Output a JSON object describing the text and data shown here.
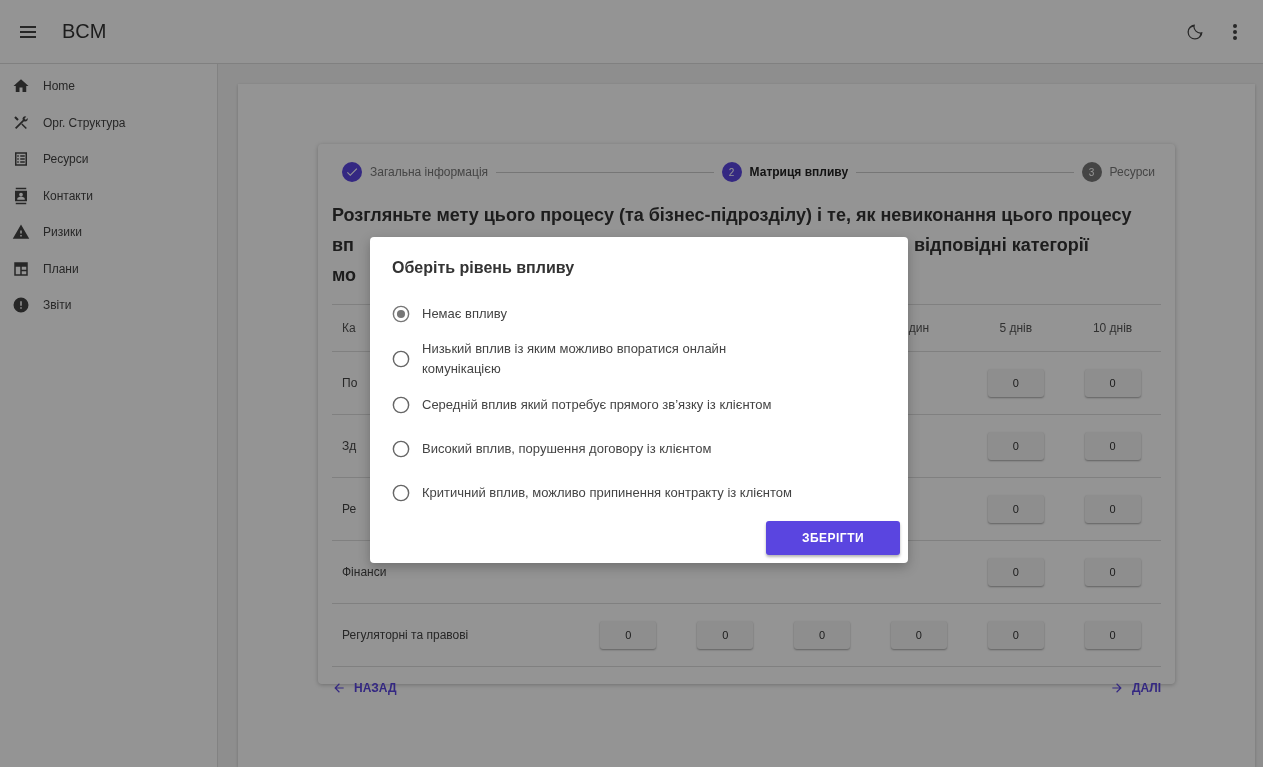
{
  "app_bar": {
    "title": "BCM"
  },
  "sidebar": {
    "items": [
      {
        "label": "Home"
      },
      {
        "label": "Орг. Структура"
      },
      {
        "label": "Ресурси"
      },
      {
        "label": "Контакти"
      },
      {
        "label": "Ризики"
      },
      {
        "label": "Плани"
      },
      {
        "label": "Звіти"
      }
    ]
  },
  "stepper": [
    {
      "label": "Загальна інформація",
      "completed": true,
      "selected": false
    },
    {
      "label": "Матриця впливу",
      "number": "2",
      "completed": false,
      "selected": true
    },
    {
      "label": "Ресурси",
      "number": "3",
      "completed": false,
      "selected": false
    }
  ],
  "heading": {
    "line_1": "Розгляньте мету цього процесу (та бізнес-підрозділу) і те, як невиконання цього процесу",
    "line_2_start": "вп",
    "line_2_end": "відповідні категорії",
    "line_3_start": "мо"
  },
  "table": {
    "label_header": "Ка",
    "columns": [
      "дин",
      "5 днів",
      "10 днів"
    ],
    "rows": [
      {
        "label": "По",
        "values": [
          "0",
          "0"
        ]
      },
      {
        "label": "Зд",
        "values": [
          "0",
          "0"
        ]
      },
      {
        "label": "Ре",
        "values": [
          "0",
          "0"
        ]
      },
      {
        "label": "Фінанси",
        "values": [
          "0",
          "0"
        ]
      },
      {
        "label": "Регуляторні та правові",
        "values": [
          "0",
          "0",
          "0",
          "0",
          "0",
          "0"
        ]
      }
    ]
  },
  "nav": {
    "back": "НАЗАД",
    "next": "ДАЛІ"
  },
  "dialog": {
    "title": "Оберіть рівень впливу",
    "options": [
      {
        "label": "Немає впливу",
        "selected": true
      },
      {
        "label": "Низький вплив із яким можливо впоратися онлайн комунікацією",
        "selected": false
      },
      {
        "label": "Середній вплив який потребує прямого зв’язку із клієнтом",
        "selected": false
      },
      {
        "label": "Високий вплив, порушення договору із клієнтом",
        "selected": false
      },
      {
        "label": "Критичний вплив, можливо припинення контракту із клієнтом",
        "selected": false
      }
    ],
    "save_button": "ЗБЕРІГТИ"
  }
}
